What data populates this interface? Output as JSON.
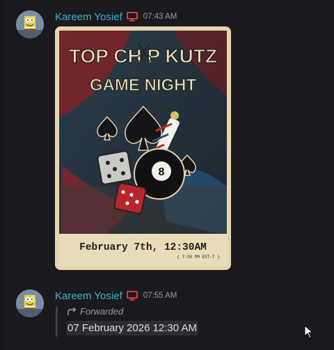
{
  "messages": [
    {
      "username": "Kareem Yosief",
      "timestamp": "07:43 AM",
      "device_icon": "desktop-monitor-icon",
      "attachment": {
        "type": "image",
        "poster": {
          "title_line1": "TOP CH  P KUTZ",
          "title_line2": "GAME NIGHT",
          "date_line": "February 7th, 12:30AM",
          "tz_line": "( 7:30 PM EST-7 )",
          "ball_number": "8"
        }
      }
    },
    {
      "username": "Kareem Yosief",
      "timestamp": "07:55 AM",
      "device_icon": "desktop-monitor-icon",
      "forwarded_label": "Forwarded",
      "forwarded_text": "07 February 2026 12:30 AM"
    }
  ],
  "colors": {
    "background": "#1a1a1e",
    "username": "#3fb4c6",
    "device_icon": "#ed4245",
    "timestamp": "#949ba4",
    "timestamp_chip": "#2b2d31"
  }
}
